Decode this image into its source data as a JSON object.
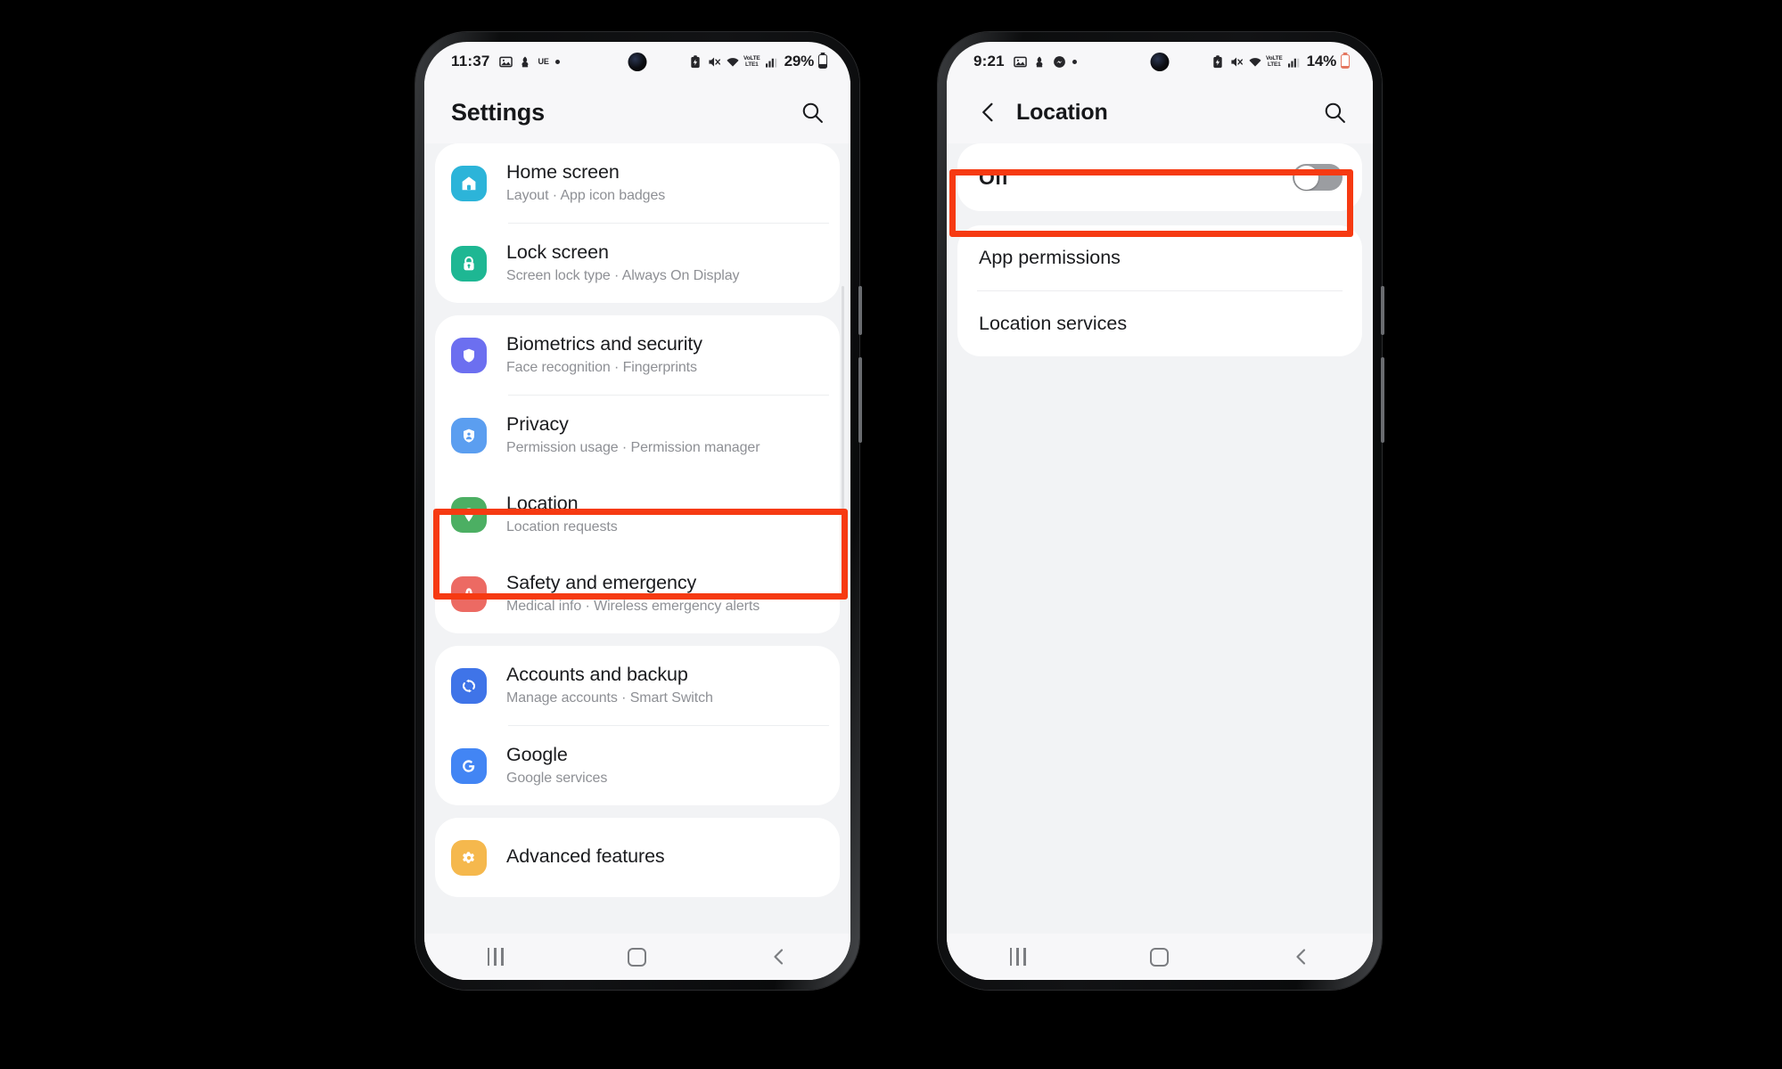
{
  "phones": {
    "left": {
      "status": {
        "time": "11:37",
        "icons": [
          "gallery-icon",
          "download-icon",
          "ue-badge",
          "dot-indicator"
        ],
        "ue_text": "UE",
        "battery_percent": "29%",
        "right_icons": [
          "battery-saver-icon",
          "mute-icon",
          "wifi-icon",
          "volte-icon",
          "signal-icon"
        ],
        "volte_top": "VoLTE",
        "volte_bottom": "LTE1"
      },
      "header": {
        "title": "Settings",
        "search_icon": "search-icon"
      },
      "groups": [
        {
          "items": [
            {
              "title": "Home screen",
              "subtitle": "Layout  ·  App icon badges",
              "icon": "home-icon",
              "color": "#2cb4d9"
            },
            {
              "title": "Lock screen",
              "subtitle": "Screen lock type  ·  Always On Display",
              "icon": "lock-icon",
              "color": "#1eb793"
            }
          ]
        },
        {
          "items": [
            {
              "title": "Biometrics and security",
              "subtitle": "Face recognition  ·  Fingerprints",
              "icon": "shield-icon",
              "color": "#6c6ff0"
            },
            {
              "title": "Privacy",
              "subtitle": "Permission usage  ·  Permission manager",
              "icon": "privacy-shield-icon",
              "color": "#5b9ef0"
            },
            {
              "title": "Location",
              "subtitle": "Location requests",
              "icon": "location-pin-icon",
              "color": "#4caf63",
              "highlighted": true
            },
            {
              "title": "Safety and emergency",
              "subtitle": "Medical info  ·  Wireless emergency alerts",
              "icon": "siren-icon",
              "color": "#ec6a63"
            }
          ]
        },
        {
          "items": [
            {
              "title": "Accounts and backup",
              "subtitle": "Manage accounts  ·  Smart Switch",
              "icon": "sync-icon",
              "color": "#3f74e8"
            },
            {
              "title": "Google",
              "subtitle": "Google services",
              "icon": "google-g-icon",
              "color": "#4285f4"
            }
          ]
        },
        {
          "items": [
            {
              "title": "Advanced features",
              "subtitle": "",
              "icon": "gear-star-icon",
              "color": "#f5b84d"
            }
          ]
        }
      ],
      "navbar": [
        "recents-button",
        "home-button",
        "back-button"
      ]
    },
    "right": {
      "status": {
        "time": "9:21",
        "icons": [
          "gallery-icon",
          "download-icon",
          "messenger-icon",
          "dot-indicator"
        ],
        "battery_percent": "14%",
        "right_icons": [
          "battery-saver-icon",
          "mute-icon",
          "wifi-icon",
          "volte-icon",
          "signal-icon"
        ],
        "volte_top": "VoLTE",
        "volte_bottom": "LTE1"
      },
      "header": {
        "back_icon": "back-chevron-icon",
        "title": "Location",
        "search_icon": "search-icon"
      },
      "toggle": {
        "label": "Off",
        "state": "off",
        "highlighted": true
      },
      "items": [
        {
          "label": "App permissions"
        },
        {
          "label": "Location services"
        }
      ],
      "navbar": [
        "recents-button",
        "home-button",
        "back-button"
      ]
    }
  },
  "highlight_color": "#f63a12"
}
